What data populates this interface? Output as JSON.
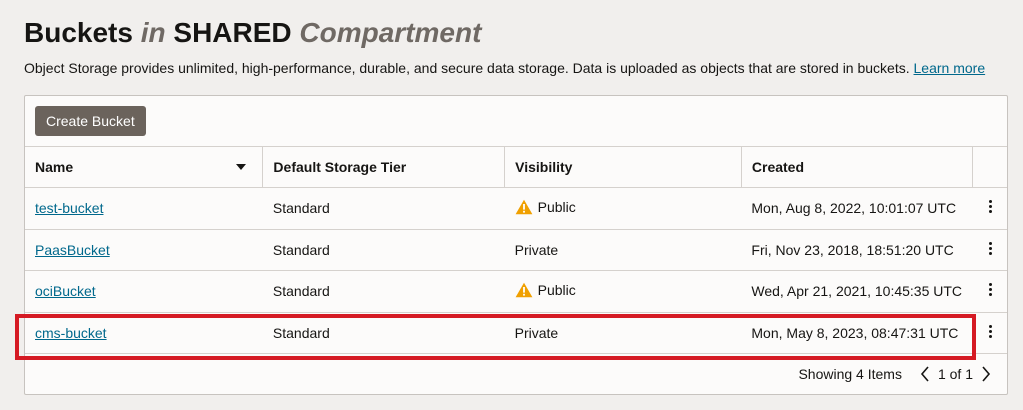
{
  "header": {
    "title_prefix": "Buckets",
    "title_in": "in",
    "title_compartment": "SHARED",
    "title_suffix": "Compartment",
    "description": "Object Storage provides unlimited, high-performance, durable, and secure data storage. Data is uploaded as objects that are stored in buckets. ",
    "learn_more": "Learn more"
  },
  "toolbar": {
    "create_label": "Create Bucket"
  },
  "table": {
    "columns": [
      "Name",
      "Default Storage Tier",
      "Visibility",
      "Created"
    ],
    "rows": [
      {
        "name": "test-bucket",
        "tier": "Standard",
        "visibility": "Public",
        "warning": true,
        "created": "Mon, Aug 8, 2022, 10:01:07 UTC"
      },
      {
        "name": "PaasBucket",
        "tier": "Standard",
        "visibility": "Private",
        "warning": false,
        "created": "Fri, Nov 23, 2018, 18:51:20 UTC"
      },
      {
        "name": "ociBucket",
        "tier": "Standard",
        "visibility": "Public",
        "warning": true,
        "created": "Wed, Apr 21, 2021, 10:45:35 UTC"
      },
      {
        "name": "cms-bucket",
        "tier": "Standard",
        "visibility": "Private",
        "warning": false,
        "created": "Mon, May 8, 2023, 08:47:31 UTC"
      }
    ]
  },
  "footer": {
    "showing": "Showing 4 Items",
    "page": "1 of 1"
  },
  "colors": {
    "highlight": "#d51a23",
    "link": "#00688c",
    "warning": "#f0a000"
  }
}
